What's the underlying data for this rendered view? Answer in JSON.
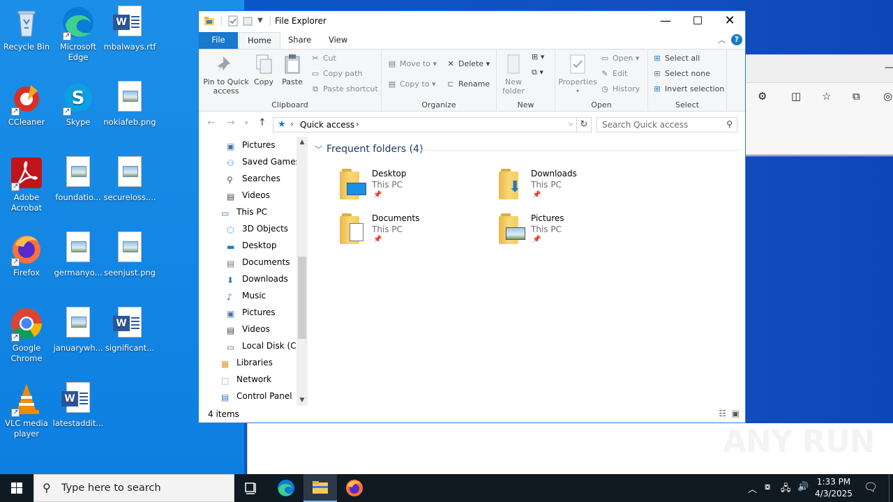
{
  "desktop": {
    "icons": [
      {
        "label": "Recycle Bin"
      },
      {
        "label": "Microsoft Edge"
      },
      {
        "label": "mbalways.rtf"
      },
      {
        "label": "CCleaner"
      },
      {
        "label": "Skype"
      },
      {
        "label": "nokiafeb.png"
      },
      {
        "label": "Adobe Acrobat"
      },
      {
        "label": "foundatio..."
      },
      {
        "label": "secureloss...."
      },
      {
        "label": "Firefox"
      },
      {
        "label": "germanyo..."
      },
      {
        "label": "seenjust.png"
      },
      {
        "label": "Google Chrome"
      },
      {
        "label": "januarywh..."
      },
      {
        "label": "significant..."
      },
      {
        "label": "VLC media player"
      },
      {
        "label": "latestaddit..."
      }
    ]
  },
  "explorer": {
    "title": "File Explorer",
    "tabs": {
      "file": "File",
      "home": "Home",
      "share": "Share",
      "view": "View"
    },
    "ribbon": {
      "clipboard": {
        "label": "Clipboard",
        "pin": "Pin to Quick access",
        "copy": "Copy",
        "paste": "Paste",
        "cut": "Cut",
        "copy_path": "Copy path",
        "paste_shortcut": "Paste shortcut"
      },
      "organize": {
        "label": "Organize",
        "move_to": "Move to",
        "copy_to": "Copy to",
        "delete": "Delete",
        "rename": "Rename"
      },
      "new": {
        "label": "New",
        "new_folder": "New folder"
      },
      "open": {
        "label": "Open",
        "properties": "Properties",
        "open": "Open",
        "edit": "Edit",
        "history": "History"
      },
      "select": {
        "label": "Select",
        "select_all": "Select all",
        "select_none": "Select none",
        "invert": "Invert selection"
      }
    },
    "address": {
      "crumb": "Quick access"
    },
    "search": {
      "placeholder": "Search Quick access"
    },
    "nav": [
      {
        "label": "Pictures"
      },
      {
        "label": "Saved Games"
      },
      {
        "label": "Searches"
      },
      {
        "label": "Videos"
      },
      {
        "label": "This PC"
      },
      {
        "label": "3D Objects"
      },
      {
        "label": "Desktop"
      },
      {
        "label": "Documents"
      },
      {
        "label": "Downloads"
      },
      {
        "label": "Music"
      },
      {
        "label": "Pictures"
      },
      {
        "label": "Videos"
      },
      {
        "label": "Local Disk (C:)"
      },
      {
        "label": "Libraries"
      },
      {
        "label": "Network"
      },
      {
        "label": "Control Panel"
      }
    ],
    "section": "Frequent folders (4)",
    "folders": [
      {
        "name": "Desktop",
        "location": "This PC"
      },
      {
        "name": "Downloads",
        "location": "This PC"
      },
      {
        "name": "Documents",
        "location": "This PC"
      },
      {
        "name": "Pictures",
        "location": "This PC"
      }
    ],
    "status": "4 items"
  },
  "taskbar": {
    "search_placeholder": "Type here to search",
    "time": "1:33 PM",
    "date": "4/3/2025"
  },
  "watermark": "ANY RUN",
  "colors": {
    "accent": "#1979ca",
    "taskbar": "#101a23",
    "desktop": "#1b8fe8"
  }
}
